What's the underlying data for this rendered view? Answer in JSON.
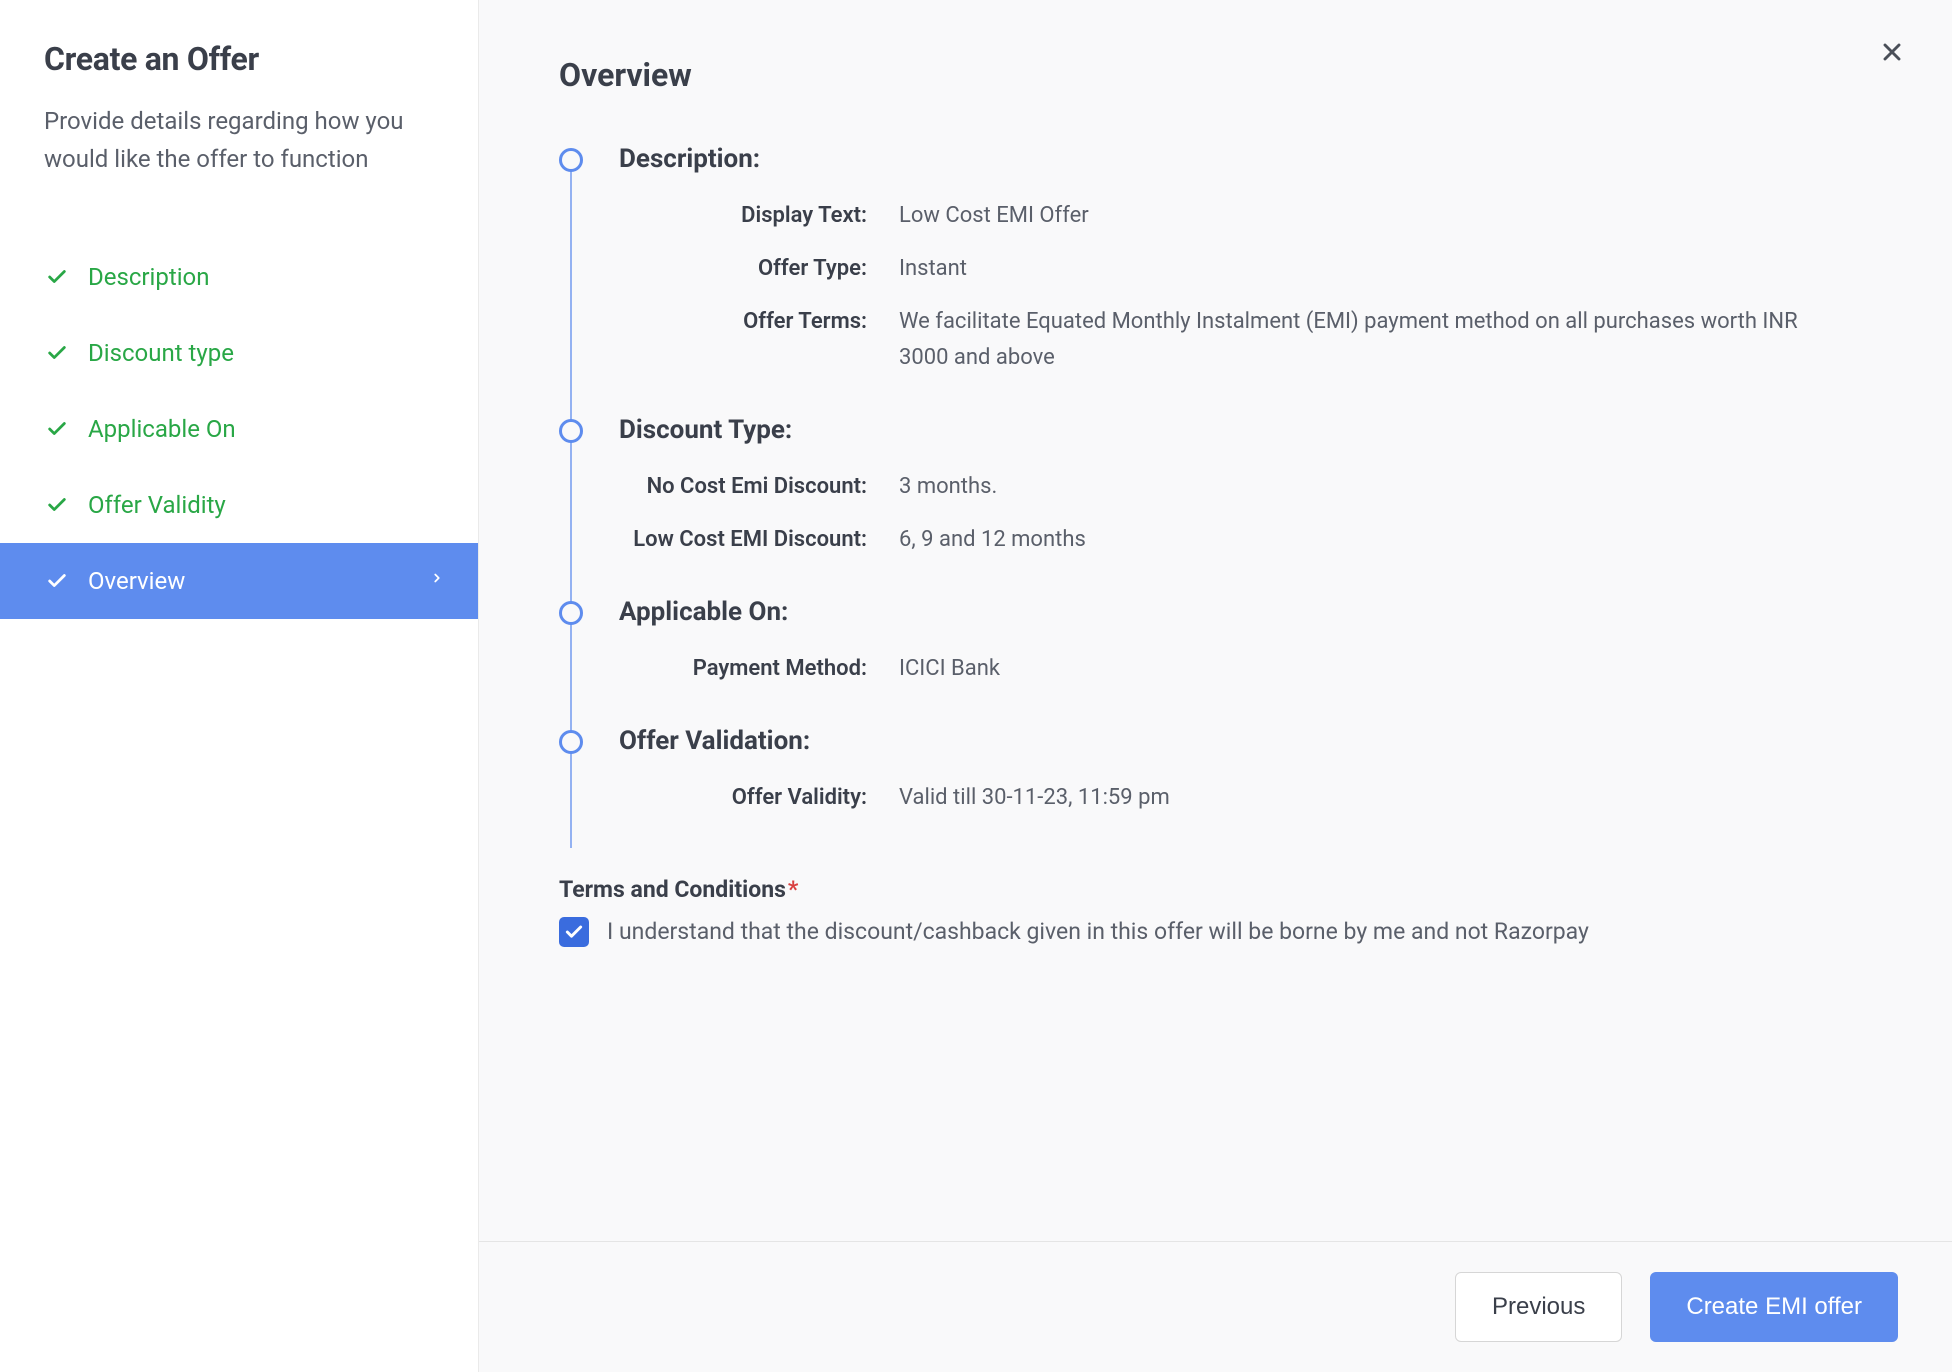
{
  "sidebar": {
    "title": "Create an Offer",
    "description": "Provide details regarding how you would like the offer to function",
    "nav": [
      {
        "label": "Description"
      },
      {
        "label": "Discount type"
      },
      {
        "label": "Applicable On"
      },
      {
        "label": "Offer Validity"
      },
      {
        "label": "Overview"
      }
    ]
  },
  "main": {
    "title": "Overview",
    "sections": {
      "description": {
        "title": "Description:",
        "display_text_label": "Display Text:",
        "display_text_value": "Low Cost EMI Offer",
        "offer_type_label": "Offer Type:",
        "offer_type_value": "Instant",
        "offer_terms_label": "Offer Terms:",
        "offer_terms_value": "We facilitate Equated Monthly Instalment (EMI) payment method on all purchases worth INR 3000 and above"
      },
      "discount_type": {
        "title": "Discount Type:",
        "no_cost_label": "No Cost Emi Discount:",
        "no_cost_value": "3 months.",
        "low_cost_label": "Low Cost EMI Discount:",
        "low_cost_value": "6, 9 and 12 months"
      },
      "applicable_on": {
        "title": "Applicable On:",
        "payment_method_label": "Payment Method:",
        "payment_method_value": "ICICI Bank"
      },
      "offer_validation": {
        "title": "Offer Validation:",
        "validity_label": "Offer Validity:",
        "validity_value": "Valid till 30-11-23, 11:59 pm"
      }
    },
    "terms": {
      "title": "Terms and Conditions",
      "checkbox_text": "I understand that the discount/cashback given in this offer will be borne by me and not Razorpay",
      "checked": true
    }
  },
  "footer": {
    "previous": "Previous",
    "create": "Create EMI offer"
  }
}
